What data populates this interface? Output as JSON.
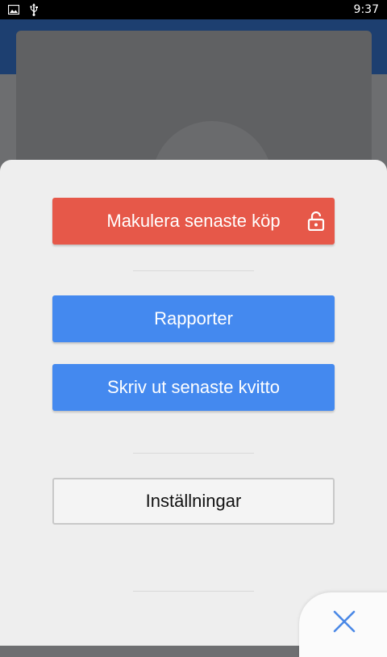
{
  "status_bar": {
    "time": "9:37",
    "icons": [
      "image-icon",
      "usb-icon"
    ]
  },
  "sheet": {
    "void_button_label": "Makulera senaste köp",
    "void_button_icon": "unlock-icon",
    "reports_button_label": "Rapporter",
    "reprint_button_label": "Skriv ut senaste kvitto",
    "settings_button_label": "Inställningar",
    "close_icon": "close-icon"
  },
  "colors": {
    "danger": "#e65849",
    "primary": "#4489ef",
    "sheet_bg": "#eeeeee",
    "header_bg": "#1d3f70"
  }
}
